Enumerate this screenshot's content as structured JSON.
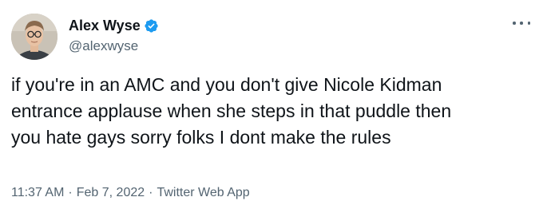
{
  "author": {
    "display_name": "Alex Wyse",
    "handle": "@alexwyse",
    "verified": true,
    "verified_icon": "verified-badge-icon",
    "verified_color": "#1d9bf0"
  },
  "more_icon": "more-options-icon",
  "tweet": {
    "text_lines": [
      "if you're in an AMC and you don't give Nicole Kidman",
      "entrance applause when she steps in that puddle then",
      "you hate gays sorry folks I dont make the rules"
    ]
  },
  "meta": {
    "time": "11:37 AM",
    "separator": "·",
    "date": "Feb 7, 2022",
    "source": "Twitter Web App"
  }
}
